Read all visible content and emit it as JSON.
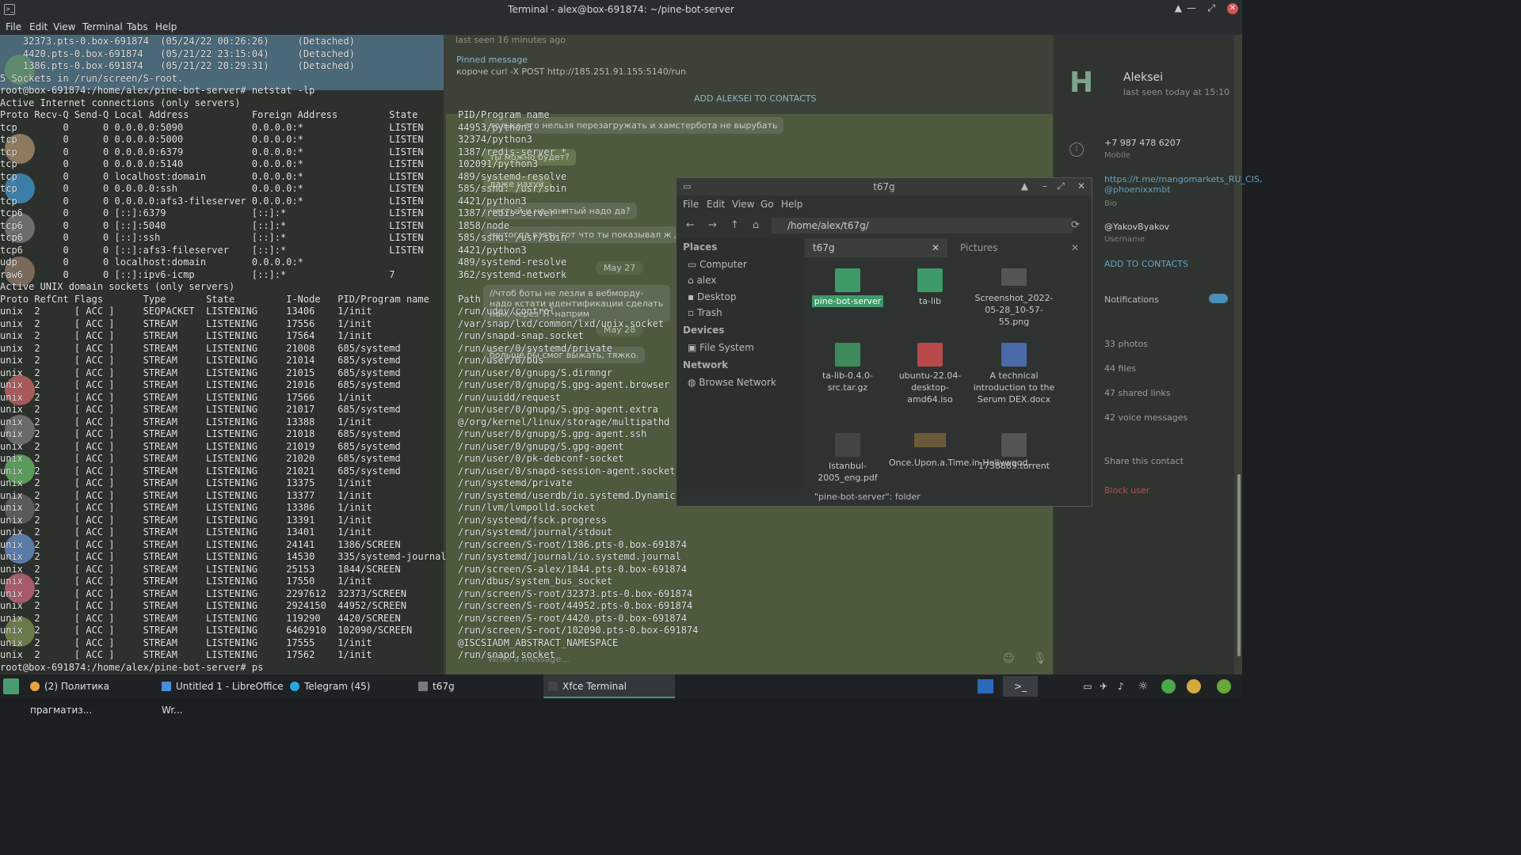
{
  "window": {
    "title": "Terminal - alex@box-691874: ~/pine-bot-server",
    "menu": [
      "File",
      "Edit",
      "View",
      "Terminal",
      "Tabs",
      "Help"
    ]
  },
  "terminal": {
    "lines": [
      "    32373.pts-0.box-691874  (05/24/22 00:26:26)     (Detached)",
      "    4420.pts-0.box-691874   (05/21/22 23:15:04)     (Detached)",
      "    1386.pts-0.box-691874   (05/21/22 20:29:31)     (Detached)",
      "5 Sockets in /run/screen/S-root.",
      "root@box-691874:/home/alex/pine-bot-server# netstat -lp",
      "Active Internet connections (only servers)",
      "Proto Recv-Q Send-Q Local Address           Foreign Address         State       PID/Program name",
      "tcp        0      0 0.0.0.0:5090            0.0.0.0:*               LISTEN      44953/python3",
      "tcp        0      0 0.0.0.0:5000            0.0.0.0:*               LISTEN      32374/python3",
      "tcp        0      0 0.0.0.0:6379            0.0.0.0:*               LISTEN      1387/redis-server *",
      "tcp        0      0 0.0.0.0:5140            0.0.0.0:*               LISTEN      102091/python3",
      "tcp        0      0 localhost:domain        0.0.0.0:*               LISTEN      489/systemd-resolve",
      "tcp        0      0 0.0.0.0:ssh             0.0.0.0:*               LISTEN      585/sshd: /usr/sbin",
      "tcp        0      0 0.0.0.0:afs3-fileserver 0.0.0.0:*               LISTEN      4421/python3",
      "tcp6       0      0 [::]:6379               [::]:*                  LISTEN      1387/redis-server *",
      "tcp6       0      0 [::]:5040               [::]:*                  LISTEN      1858/node",
      "tcp6       0      0 [::]:ssh                [::]:*                  LISTEN      585/sshd: /usr/sbin",
      "tcp6       0      0 [::]:afs3-fileserver    [::]:*                  LISTEN      4421/python3",
      "udp        0      0 localhost:domain        0.0.0.0:*                           489/systemd-resolve",
      "raw6       0      0 [::]:ipv6-icmp          [::]:*                  7           362/systemd-network",
      "Active UNIX domain sockets (only servers)",
      "Proto RefCnt Flags       Type       State         I-Node   PID/Program name     Path",
      "unix  2      [ ACC ]     SEQPACKET  LISTENING     13406    1/init               /run/udev/control",
      "unix  2      [ ACC ]     STREAM     LISTENING     17556    1/init               /var/snap/lxd/common/lxd/unix.socket",
      "unix  2      [ ACC ]     STREAM     LISTENING     17564    1/init               /run/snapd-snap.socket",
      "unix  2      [ ACC ]     STREAM     LISTENING     21008    685/systemd          /run/user/0/systemd/private",
      "unix  2      [ ACC ]     STREAM     LISTENING     21014    685/systemd          /run/user/0/bus",
      "unix  2      [ ACC ]     STREAM     LISTENING     21015    685/systemd          /run/user/0/gnupg/S.dirmngr",
      "unix  2      [ ACC ]     STREAM     LISTENING     21016    685/systemd          /run/user/0/gnupg/S.gpg-agent.browser",
      "unix  2      [ ACC ]     STREAM     LISTENING     17566    1/init               /run/uuidd/request",
      "unix  2      [ ACC ]     STREAM     LISTENING     21017    685/systemd          /run/user/0/gnupg/S.gpg-agent.extra",
      "unix  2      [ ACC ]     STREAM     LISTENING     13388    1/init               @/org/kernel/linux/storage/multipathd",
      "unix  2      [ ACC ]     STREAM     LISTENING     21018    685/systemd          /run/user/0/gnupg/S.gpg-agent.ssh",
      "unix  2      [ ACC ]     STREAM     LISTENING     21019    685/systemd          /run/user/0/gnupg/S.gpg-agent",
      "unix  2      [ ACC ]     STREAM     LISTENING     21020    685/systemd          /run/user/0/pk-debconf-socket",
      "unix  2      [ ACC ]     STREAM     LISTENING     21021    685/systemd          /run/user/0/snapd-session-agent.socket",
      "unix  2      [ ACC ]     STREAM     LISTENING     13375    1/init               /run/systemd/private",
      "unix  2      [ ACC ]     STREAM     LISTENING     13377    1/init               /run/systemd/userdb/io.systemd.DynamicUser",
      "unix  2      [ ACC ]     STREAM     LISTENING     13386    1/init               /run/lvm/lvmpolld.socket",
      "unix  2      [ ACC ]     STREAM     LISTENING     13391    1/init               /run/systemd/fsck.progress",
      "unix  2      [ ACC ]     STREAM     LISTENING     13401    1/init               /run/systemd/journal/stdout",
      "unix  2      [ ACC ]     STREAM     LISTENING     24141    1386/SCREEN          /run/screen/S-root/1386.pts-0.box-691874",
      "unix  2      [ ACC ]     STREAM     LISTENING     14530    335/systemd-journal  /run/systemd/journal/io.systemd.journal",
      "unix  2      [ ACC ]     STREAM     LISTENING     25153    1844/SCREEN          /run/screen/S-alex/1844.pts-0.box-691874",
      "unix  2      [ ACC ]     STREAM     LISTENING     17550    1/init               /run/dbus/system_bus_socket",
      "unix  2      [ ACC ]     STREAM     LISTENING     2297612  32373/SCREEN         /run/screen/S-root/32373.pts-0.box-691874",
      "unix  2      [ ACC ]     STREAM     LISTENING     2924150  44952/SCREEN         /run/screen/S-root/44952.pts-0.box-691874",
      "unix  2      [ ACC ]     STREAM     LISTENING     119290   4420/SCREEN          /run/screen/S-root/4420.pts-0.box-691874",
      "unix  2      [ ACC ]     STREAM     LISTENING     6462910  102090/SCREEN        /run/screen/S-root/102090.pts-0.box-691874",
      "unix  2      [ ACC ]     STREAM     LISTENING     17555    1/init               @ISCSIADM_ABSTRACT_NAMESPACE",
      "unix  2      [ ACC ]     STREAM     LISTENING     17562    1/init               /run/snapd.socket",
      "root@box-691874:/home/alex/pine-bot-server# ps"
    ]
  },
  "telegram": {
    "last_seen": "last seen 16 minutes ago",
    "pinned_label": "Pinned message",
    "pinned_text": "короче  curl -X POST  http://185.251.91.155:5140/run",
    "add_contacts": "ADD ALEKSEI TO CONTACTS",
    "messages": [
      "только его нельзя перезагружать и хамстербота не вырубать",
      "ты можно будет?",
      "даже нахуй",
      "чистый и не занятый надо да?",
      "ну тогда взять тот что ты показывал ж дешевый"
    ],
    "date_1": "May 27",
    "date_2": "May 28",
    "msg_bot": "//чтоб боты не лезли в вебморду- надо кстати идентификации сделать нам, через ТГ наприм",
    "msg_cant": "больше бы смог выжать, тяжко.",
    "compose_placeholder": "Write a message...",
    "profile": {
      "name": "Aleksei",
      "seen": "last seen today at 15:10",
      "phone": "+7 987 478 6207",
      "phone_label": "Mobile",
      "bio": "https://t.me/mangomarkets_RU_CIS, @phoenixxmbt",
      "bio_label": "Bio",
      "username": "@YakovByakov",
      "username_label": "Username",
      "add_to_contacts": "ADD TO CONTACTS",
      "notifications": "Notifications",
      "photos": "33 photos",
      "files": "44 files",
      "links": "47 shared links",
      "voice": "42 voice messages",
      "share": "Share this contact",
      "block": "Block user"
    }
  },
  "file_manager": {
    "title": "t67g",
    "menu": [
      "File",
      "Edit",
      "View",
      "Go",
      "Help"
    ],
    "path": "/home/alex/t67g/",
    "places_header": "Places",
    "places": [
      "Computer",
      "alex",
      "Desktop",
      "Trash"
    ],
    "devices_header": "Devices",
    "devices": [
      "File System"
    ],
    "network_header": "Network",
    "network": [
      "Browse Network"
    ],
    "tabs": [
      "t67g",
      "Pictures"
    ],
    "files": [
      {
        "name": "pine-bot-server",
        "kind": "folder"
      },
      {
        "name": "ta-lib",
        "kind": "folder"
      },
      {
        "name": "Screenshot_2022-05-28_10-57-55.png",
        "kind": "image"
      },
      {
        "name": "ta-lib-0.4.0-src.tar.gz",
        "kind": "archive"
      },
      {
        "name": "ubuntu-22.04-desktop-amd64.iso",
        "kind": "disc"
      },
      {
        "name": "A technical introduction to the Serum DEX.docx",
        "kind": "document"
      },
      {
        "name": "Istanbul-2005_eng.pdf",
        "kind": "pdf"
      },
      {
        "name": "Once.Upon.a.Time.in.Hollywood.",
        "kind": "video"
      },
      {
        "name": "1738889.torrent",
        "kind": "torrent"
      }
    ],
    "status": "\"pine-bot-server\": folder"
  },
  "taskbar": {
    "tasks": [
      {
        "label": "(2) Политика прагматиз...",
        "color": "#e8a33d"
      },
      {
        "label": "Untitled 1 - LibreOffice Wr...",
        "color": "#4a90d9"
      },
      {
        "label": "Telegram (45)",
        "color": "#2ea6e0"
      },
      {
        "label": "t67g",
        "color": "#7a7a7a"
      },
      {
        "label": "Xfce Terminal",
        "color": "#444"
      }
    ],
    "terminal_badge": "2"
  }
}
